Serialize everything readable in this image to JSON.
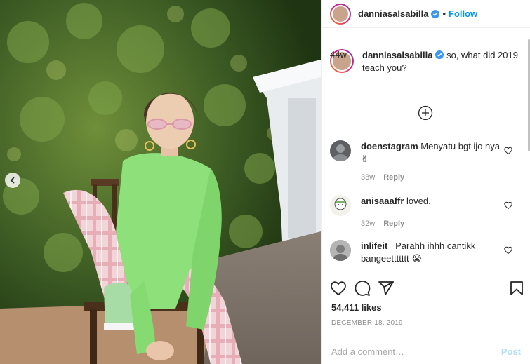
{
  "post": {
    "author": "danniasalsabilla",
    "follow_label": "Follow",
    "separator": "•",
    "caption_text": "so, what did 2019 teach you?",
    "caption_time": "44w",
    "likes": "54,411 likes",
    "date": "DECEMBER 18, 2019"
  },
  "comments": [
    {
      "user": "doenstagram",
      "text": "Menyatu bgt ijo nya ✌",
      "time": "33w",
      "reply_label": "Reply"
    },
    {
      "user": "anisaaaffr",
      "text": "loved.",
      "time": "32w",
      "reply_label": "Reply"
    },
    {
      "user": "inlifeit_",
      "text": "Parahh ihhh cantikk bangeettttttt 😭",
      "time": "",
      "reply_label": ""
    }
  ],
  "composer": {
    "placeholder": "Add a comment…",
    "post_label": "Post"
  },
  "icons": {
    "verified": "verified-badge-icon",
    "load_more": "plus-circle-icon",
    "heart": "heart-icon",
    "comment": "comment-icon",
    "share": "share-icon",
    "save": "bookmark-icon",
    "carousel_prev": "chevron-left-icon"
  },
  "colors": {
    "link_blue": "#0095f6",
    "post_disabled": "#b2dffc",
    "muted": "#8e8e8e",
    "text": "#262626"
  }
}
